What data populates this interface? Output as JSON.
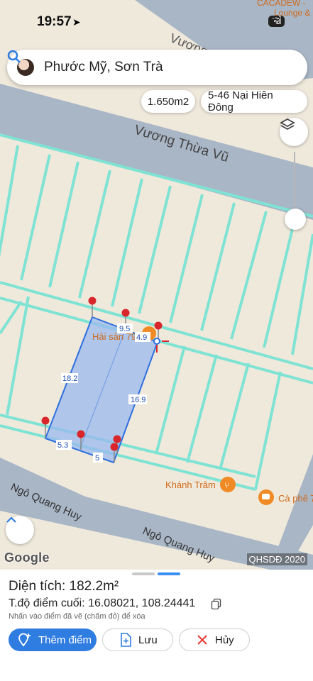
{
  "status_bar": {
    "time": "19:57",
    "battery": "28"
  },
  "search": {
    "query": "Phước Mỹ, Sơn Trà"
  },
  "chips": {
    "area": "1.650m2",
    "address": "5-46 Nại Hiên Đông"
  },
  "map": {
    "labels": {
      "top_corner_1": "CACADEW -",
      "top_corner_2": "Lounge &",
      "road_top": "Vương",
      "road_main": "Vương Thừa Vũ",
      "poi_restaurant": "Hải sản 79",
      "poi_khanh_tram": "Khánh Trâm",
      "poi_cafe": "Cà phê 7",
      "road_bottom_left": "Ngô Quang Huy",
      "road_bottom_right": "Ngô Quang Huy"
    },
    "measure_labels": {
      "top_short": "9.5",
      "top_right": "4.9",
      "left_side": "18.2",
      "right_side": "16.9",
      "bottom_left": "5.3",
      "bottom": "5"
    },
    "credit": "QHSDĐ 2020",
    "logo": "Google",
    "colors": {
      "lot_lines": "#7fe3d4",
      "polygon_fill": "#9ab8ef",
      "polygon_stroke": "#2f6fe0",
      "pin": "#d9262b",
      "poi": "#f08a24"
    }
  },
  "panel": {
    "area": "Diện tích: 182.2m²",
    "coordinates": "T.độ điểm cuối: 16.08021, 108.24441",
    "hint": "Nhấn vào điểm đã vẽ (chấm đỏ) để xóa",
    "buttons": {
      "add_point": "Thêm điểm",
      "save": "Lưu",
      "cancel": "Hủy"
    }
  }
}
